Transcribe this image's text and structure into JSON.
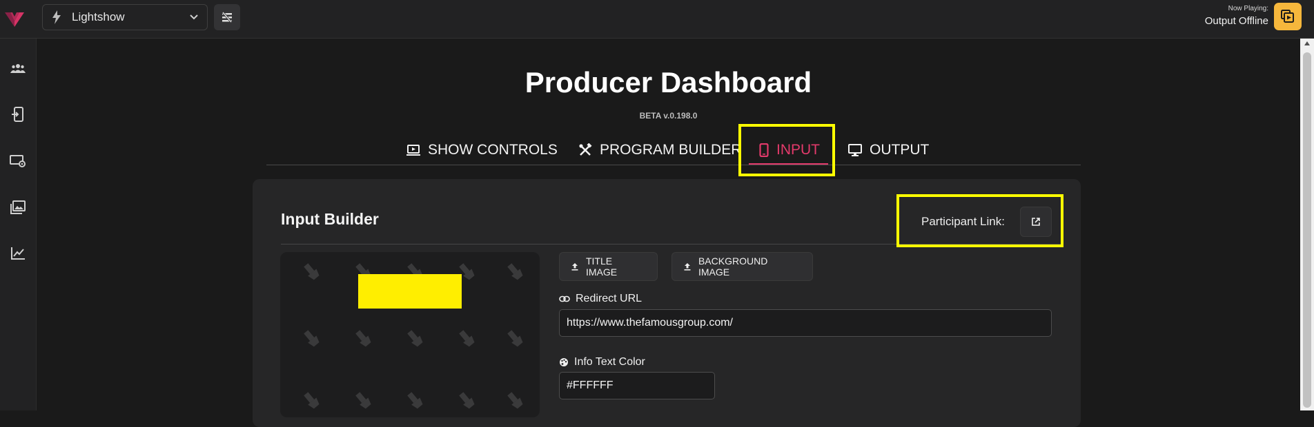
{
  "topbar": {
    "show_select": {
      "value": "Lightshow"
    },
    "now_playing": {
      "label": "Now Playing:",
      "value": "Output Offline"
    }
  },
  "sidebar": {
    "items": [
      {
        "icon": "users-icon"
      },
      {
        "icon": "phone-login-icon"
      },
      {
        "icon": "display-settings-icon"
      },
      {
        "icon": "image-library-icon"
      },
      {
        "icon": "analytics-chart-icon"
      }
    ]
  },
  "page": {
    "title": "Producer Dashboard",
    "version": "BETA v.0.198.0"
  },
  "tabs": [
    {
      "label": "SHOW CONTROLS",
      "icon": "monitor-play-icon",
      "active": false
    },
    {
      "label": "PROGRAM BUILDER",
      "icon": "tools-icon",
      "active": false
    },
    {
      "label": "INPUT",
      "icon": "mobile-phone-icon",
      "active": true
    },
    {
      "label": "OUTPUT",
      "icon": "desktop-monitor-icon",
      "active": false
    }
  ],
  "input_builder": {
    "title": "Input Builder",
    "participant_link_label": "Participant Link:",
    "title_image_button": "TITLE IMAGE",
    "background_image_button": "BACKGROUND IMAGE",
    "redirect_url": {
      "label": "Redirect URL",
      "value": "https://www.thefamousgroup.com/"
    },
    "info_text_color": {
      "label": "Info Text Color",
      "value": "#FFFFFF"
    }
  },
  "colors": {
    "accent": "#e33a6b",
    "highlight": "#ffff00",
    "now_playing_button": "#f6b73c",
    "preview_block": "#ffee00"
  }
}
